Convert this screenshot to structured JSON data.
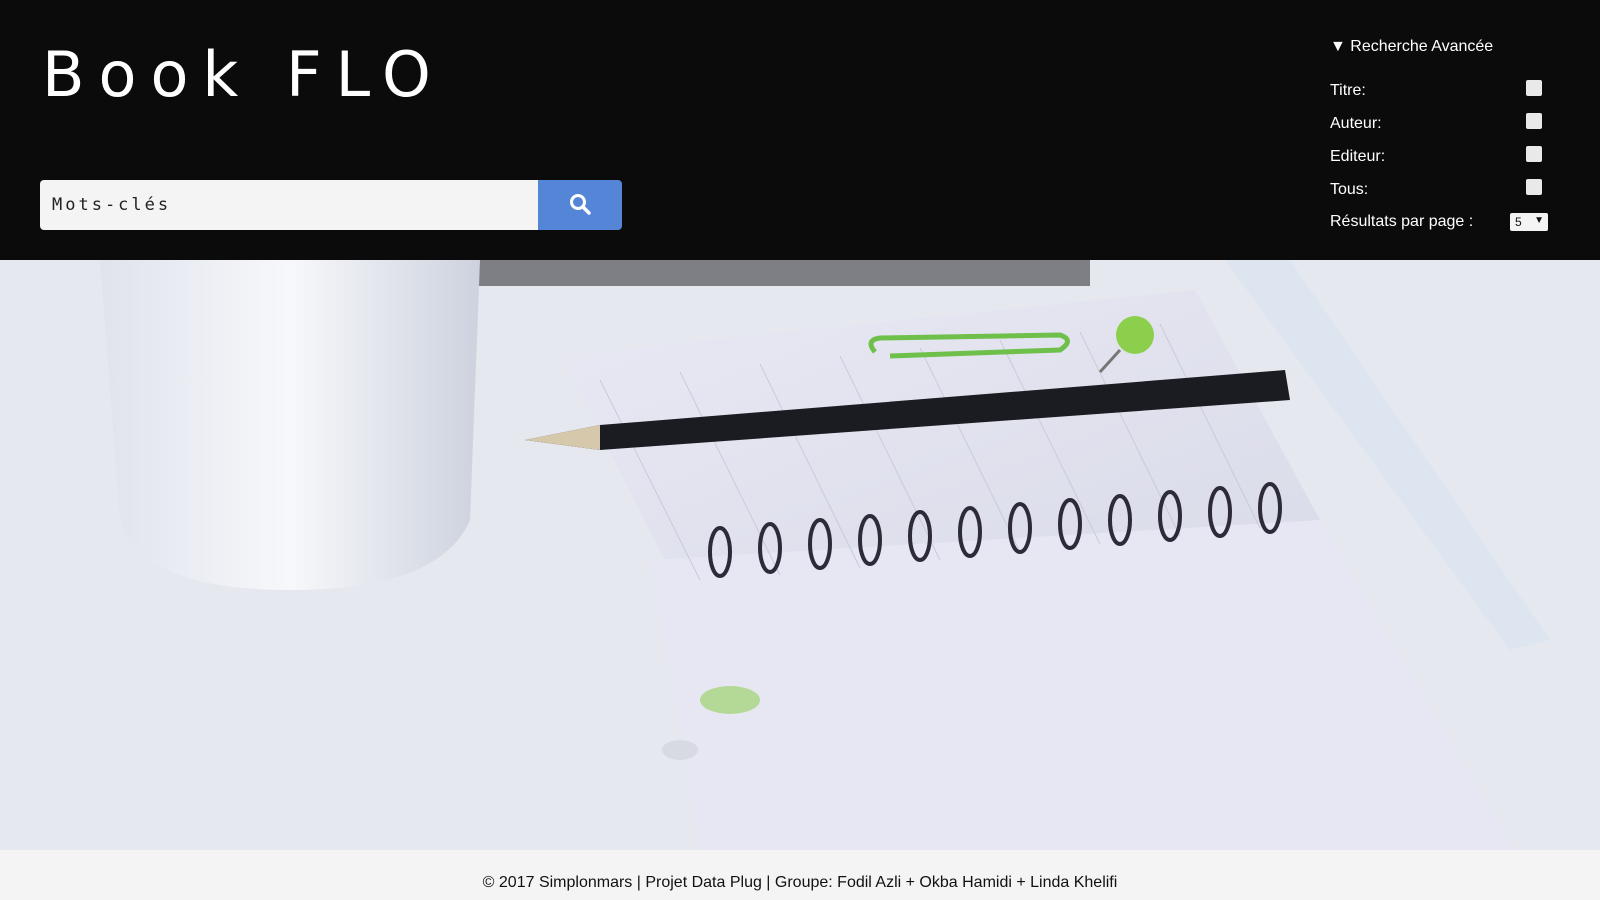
{
  "header": {
    "title": "Book FLO"
  },
  "search": {
    "placeholder": "Mots-clés",
    "button_icon": "search-icon"
  },
  "advanced": {
    "title": "▼ Recherche Avancée",
    "filters": [
      {
        "label": "Titre:",
        "checked": false
      },
      {
        "label": "Auteur:",
        "checked": false
      },
      {
        "label": "Editeur:",
        "checked": false
      },
      {
        "label": "Tous:",
        "checked": false
      }
    ],
    "results_per_page_label": "Résultats par page :",
    "results_per_page_value": "5"
  },
  "footer": {
    "text": "© 2017 Simplonmars  |  Projet Data Plug  |  Groupe: Fodil Azli + Okba Hamidi + Linda Khelifi"
  },
  "colors": {
    "header_bg": "#0b0b0b",
    "search_button": "#5585d6",
    "footer_bg": "#f4f4f4"
  }
}
